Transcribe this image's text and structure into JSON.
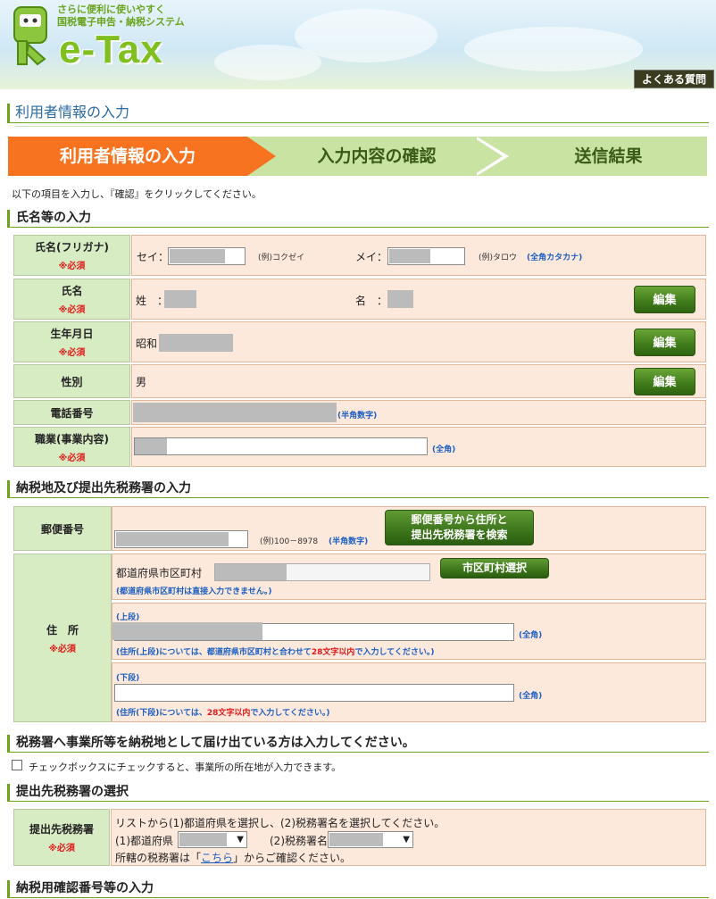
{
  "header": {
    "tagline_line1": "さらに便利に使いやすく",
    "tagline_line2": "国税電子申告・納税システム",
    "logo_text": "e-Tax",
    "faq_button": "よくある質問"
  },
  "page_title": "利用者情報の入力",
  "steps": [
    {
      "label": "利用者情報の入力"
    },
    {
      "label": "入力内容の確認"
    },
    {
      "label": "送信結果"
    }
  ],
  "instruction": "以下の項目を入力し、『確認』をクリックしてください。",
  "name_section": {
    "heading": "氏名等の入力",
    "required": "※必須",
    "kana_label": "氏名(フリガナ)",
    "sei_label": "セイ：",
    "sei_example": "(例)コクゼイ",
    "mei_label": "メイ：",
    "mei_example": "(例)タロウ",
    "kana_note": "(全角カタカナ)",
    "name_label": "氏名",
    "surname_label": "姓　：",
    "given_label": "名　：",
    "edit_button": "編集",
    "birth_label": "生年月日",
    "era_value": "昭和",
    "gender_label": "性別",
    "gender_value": "男",
    "phone_label": "電話番号",
    "phone_note": "(半角数字)",
    "job_label": "職業(事業内容)",
    "job_note": "(全角)"
  },
  "address_section": {
    "heading": "納税地及び提出先税務署の入力",
    "postal_label": "郵便番号",
    "postal_example": "(例)100－8978",
    "postal_note": "(半角数字)",
    "postal_search_line1": "郵便番号から住所と",
    "postal_search_line2": "提出先税務署を検索",
    "address_label": "住　所",
    "required": "※必須",
    "pref_city_label": "都道府県市区町村",
    "pref_city_button": "市区町村選択",
    "pref_city_note": "(都道府県市区町村は直接入力できません。)",
    "upper_label": "(上段)",
    "upper_note_prefix": "(住所(上段)については、都道府県市区町村と合わせて",
    "upper_note_limit": "28文字以内",
    "upper_note_suffix": "で入力してください。)",
    "lower_label": "(下段)",
    "lower_note_prefix": "(住所(下段)については、",
    "lower_note_limit": "28文字以内",
    "lower_note_suffix": "で入力してください。)",
    "zenkaku_note": "(全角)"
  },
  "office_section": {
    "heading": "税務署へ事業所等を納税地として届け出ている方は入力してください。",
    "checkbox_label": "チェックボックスにチェックすると、事業所の所在地が入力できます。",
    "checked": false
  },
  "tax_office_section": {
    "heading": "提出先税務署の選択",
    "label": "提出先税務署",
    "required": "※必須",
    "line1": "リストから(1)都道府県を選択し、(2)税務署名を選択してください。",
    "pref_label": "(1)都道府県",
    "office_label": "(2)税務署名",
    "line3_prefix": "所轄の税務署は「",
    "line3_link": "こちら",
    "line3_suffix": "」からご確認ください。"
  },
  "confirm_section": {
    "heading": "納税用確認番号等の入力"
  }
}
